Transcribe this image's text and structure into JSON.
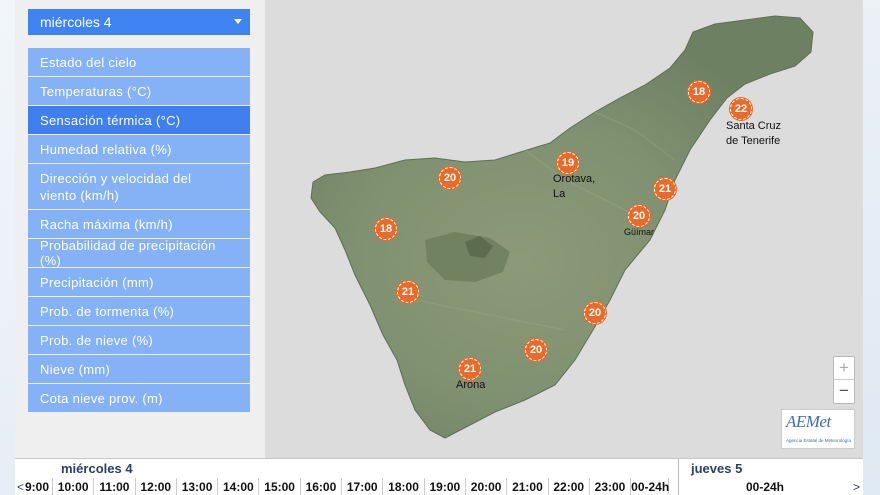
{
  "day_selector": {
    "value": "miércoles 4"
  },
  "menu": {
    "items": [
      {
        "label": "Estado del cielo",
        "active": false
      },
      {
        "label": "Temperaturas (°C)",
        "active": false
      },
      {
        "label": "Sensación térmica (°C)",
        "active": true
      },
      {
        "label": "Humedad relativa (%)",
        "active": false
      },
      {
        "label": "Dirección y velocidad del viento (km/h)",
        "active": false
      },
      {
        "label": "Racha máxima (km/h)",
        "active": false
      },
      {
        "label": "Probabilidad de precipitación (%)",
        "active": false
      },
      {
        "label": "Precipitación (mm)",
        "active": false
      },
      {
        "label": "Prob. de tormenta (%)",
        "active": false
      },
      {
        "label": "Prob. de nieve (%)",
        "active": false
      },
      {
        "label": "Nieve (mm)",
        "active": false
      },
      {
        "label": "Cota nieve prov. (m)",
        "active": false
      }
    ]
  },
  "map": {
    "markers": [
      {
        "value": "18",
        "place": ""
      },
      {
        "value": "22",
        "place": "Santa Cruz de Tenerife"
      },
      {
        "value": "19",
        "place": "Orotava, La"
      },
      {
        "value": "20",
        "place": ""
      },
      {
        "value": "21",
        "place": ""
      },
      {
        "value": "20",
        "place": "Güímar"
      },
      {
        "value": "18",
        "place": ""
      },
      {
        "value": "21",
        "place": ""
      },
      {
        "value": "20",
        "place": ""
      },
      {
        "value": "20",
        "place": ""
      },
      {
        "value": "21",
        "place": "Arona"
      }
    ],
    "zoom_in": "+",
    "zoom_out": "−",
    "marker_color": "#ea6a2a",
    "land_color": "#7d8f6c"
  },
  "logo": {
    "main": "AEMet",
    "sub": "Agencia Estatal de Meteorología"
  },
  "timeline": {
    "day1": "miércoles 4",
    "day2": "jueves 5",
    "hours": [
      "9:00",
      "10:00",
      "11:00",
      "12:00",
      "13:00",
      "14:00",
      "15:00",
      "16:00",
      "17:00",
      "18:00",
      "19:00",
      "20:00",
      "21:00",
      "22:00",
      "23:00",
      "00-24h"
    ],
    "next_range": "00-24h",
    "prev_arrow": "<",
    "next_arrow": ">"
  }
}
